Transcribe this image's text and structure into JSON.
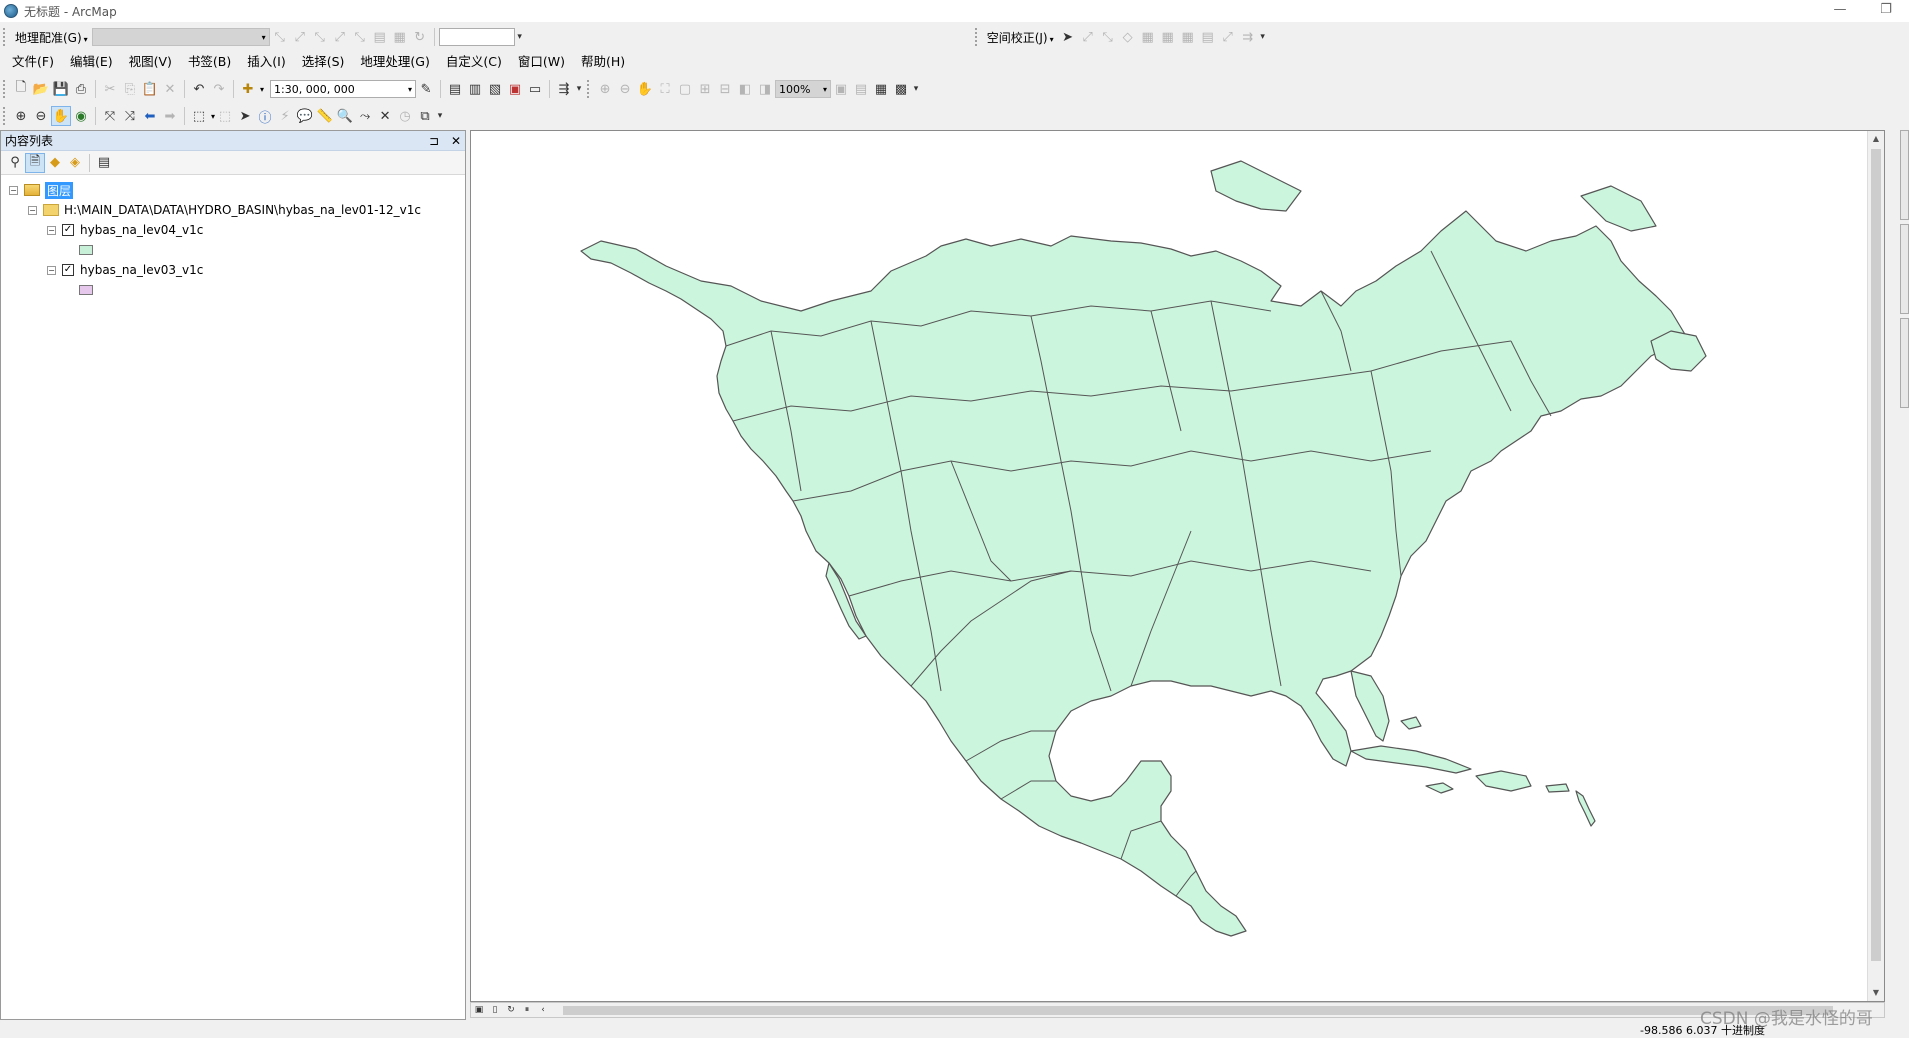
{
  "window": {
    "title": "无标题 - ArcMap",
    "min": "—",
    "restore": "❐"
  },
  "georef_toolbar": {
    "label": "地理配准(G)",
    "layer_combo": "",
    "scale_box": ""
  },
  "spatial_adjust": {
    "label": "空间校正(J)"
  },
  "menu": [
    "文件(F)",
    "编辑(E)",
    "视图(V)",
    "书签(B)",
    "插入(I)",
    "选择(S)",
    "地理处理(G)",
    "自定义(C)",
    "窗口(W)",
    "帮助(H)"
  ],
  "standard_toolbar": {
    "scale": "1:30, 000, 000",
    "zoom_percent": "100%"
  },
  "toc": {
    "title": "内容列表",
    "pin": "⊐",
    "close": "✕",
    "root_label": "图层",
    "workspace_path": "H:\\MAIN_DATA\\DATA\\HYDRO_BASIN\\hybas_na_lev01-12_v1c",
    "layers": [
      {
        "name": "hybas_na_lev04_v1c",
        "checked": "✓",
        "color": "#c8f0d8"
      },
      {
        "name": "hybas_na_lev03_v1c",
        "checked": "✓",
        "color": "#e6c8ec"
      }
    ]
  },
  "map": {
    "land_fill": "#ccf5dd",
    "border_color": "#555555"
  },
  "status": {
    "coords": "-98.586  6.037 十进制度"
  },
  "watermark": "CSDN @我是水怪的哥"
}
